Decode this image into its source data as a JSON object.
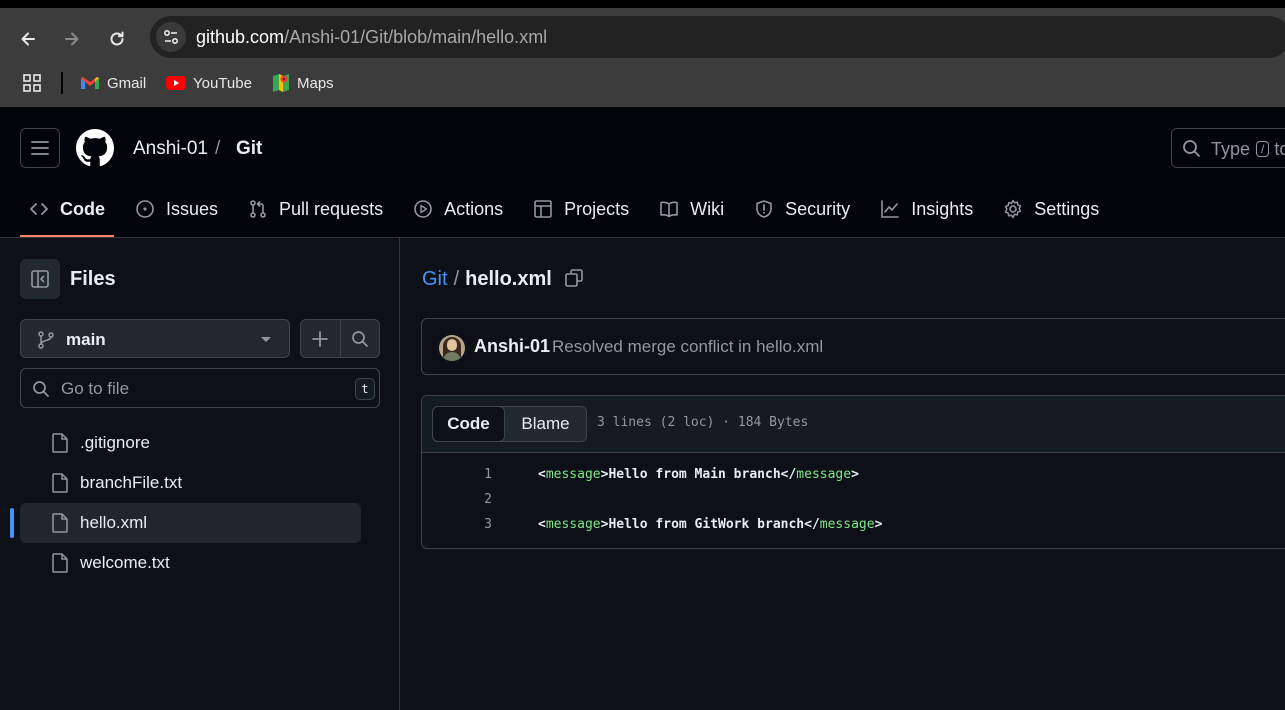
{
  "browser": {
    "url_host": "github.com",
    "url_path": "/Anshi-01/Git/blob/main/hello.xml",
    "bookmarks": [
      {
        "label": "Gmail",
        "icon": "gmail-icon"
      },
      {
        "label": "YouTube",
        "icon": "youtube-icon"
      },
      {
        "label": "Maps",
        "icon": "maps-icon"
      }
    ]
  },
  "header": {
    "owner": "Anshi-01",
    "separator": "/",
    "repo": "Git",
    "search_placeholder": "Type",
    "search_key": "/",
    "search_suffix": "to"
  },
  "repo_nav": {
    "tabs": [
      {
        "label": "Code",
        "icon": "code-icon",
        "active": true
      },
      {
        "label": "Issues",
        "icon": "issue-icon"
      },
      {
        "label": "Pull requests",
        "icon": "pull-request-icon"
      },
      {
        "label": "Actions",
        "icon": "play-icon"
      },
      {
        "label": "Projects",
        "icon": "table-icon"
      },
      {
        "label": "Wiki",
        "icon": "book-icon"
      },
      {
        "label": "Security",
        "icon": "shield-icon"
      },
      {
        "label": "Insights",
        "icon": "graph-icon"
      },
      {
        "label": "Settings",
        "icon": "gear-icon"
      }
    ]
  },
  "sidebar": {
    "title": "Files",
    "branch": "main",
    "goto_placeholder": "Go to file",
    "goto_key": "t",
    "files": [
      ".gitignore",
      "branchFile.txt",
      "hello.xml",
      "welcome.txt"
    ],
    "selected_file": "hello.xml"
  },
  "main": {
    "path_repo": "Git",
    "path_sep": "/",
    "path_file": "hello.xml",
    "commit_author": "Anshi-01",
    "commit_message": "Resolved merge conflict in hello.xml",
    "view_tabs": [
      "Code",
      "Blame"
    ],
    "file_meta": "3 lines (2 loc) · 184 Bytes",
    "lines": [
      {
        "num": "1",
        "text": "Hello from Main branch"
      },
      {
        "num": "2",
        "text": ""
      },
      {
        "num": "3",
        "text": "Hello from GitWork branch"
      }
    ],
    "xml_tag": "message"
  },
  "colors": {
    "accent_link": "#4493f8",
    "tab_underline": "#f78166",
    "xml_tag": "#7ee787"
  }
}
